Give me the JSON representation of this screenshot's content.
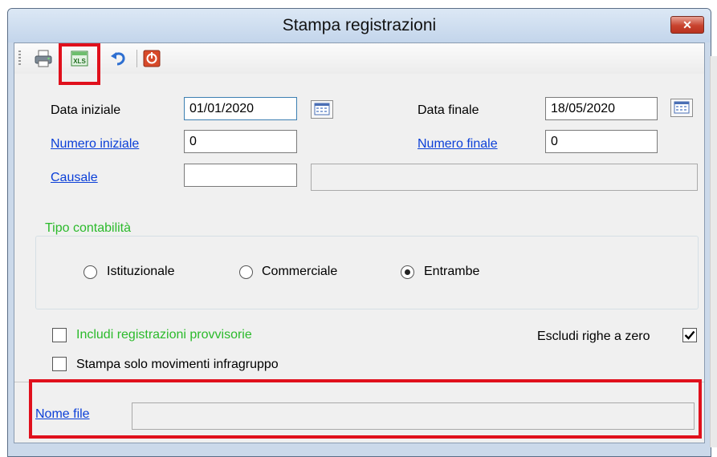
{
  "window": {
    "title": "Stampa registrazioni",
    "close_glyph": "✕"
  },
  "toolbar": {
    "icons": [
      "print-icon",
      "excel-export-icon",
      "undo-icon",
      "exit-icon"
    ],
    "excel_text": "XLS"
  },
  "form": {
    "data_iniziale": {
      "label": "Data iniziale",
      "value": "01/01/2020"
    },
    "data_finale": {
      "label": "Data finale",
      "value": "18/05/2020"
    },
    "numero_iniziale": {
      "label": "Numero iniziale",
      "value": "0"
    },
    "numero_finale": {
      "label": "Numero finale",
      "value": "0"
    },
    "causale": {
      "label": "Causale",
      "value": "",
      "description": ""
    }
  },
  "tipo_contabilita": {
    "title": "Tipo contabilità",
    "options": [
      {
        "label": "Istituzionale",
        "selected": false
      },
      {
        "label": "Commerciale",
        "selected": false
      },
      {
        "label": "Entrambe",
        "selected": true
      }
    ]
  },
  "options": {
    "provvisorie": {
      "label": "Includi registrazioni provvisorie",
      "checked": false
    },
    "infragruppo": {
      "label": "Stampa solo movimenti infragruppo",
      "checked": false
    },
    "righe_zero": {
      "label": "Escludi righe a zero",
      "checked": true
    }
  },
  "nome_file": {
    "label": "Nome file",
    "value": ""
  },
  "colors": {
    "highlight": "#e0101c",
    "link": "#0b3fd8",
    "green_label": "#2bba2b"
  }
}
